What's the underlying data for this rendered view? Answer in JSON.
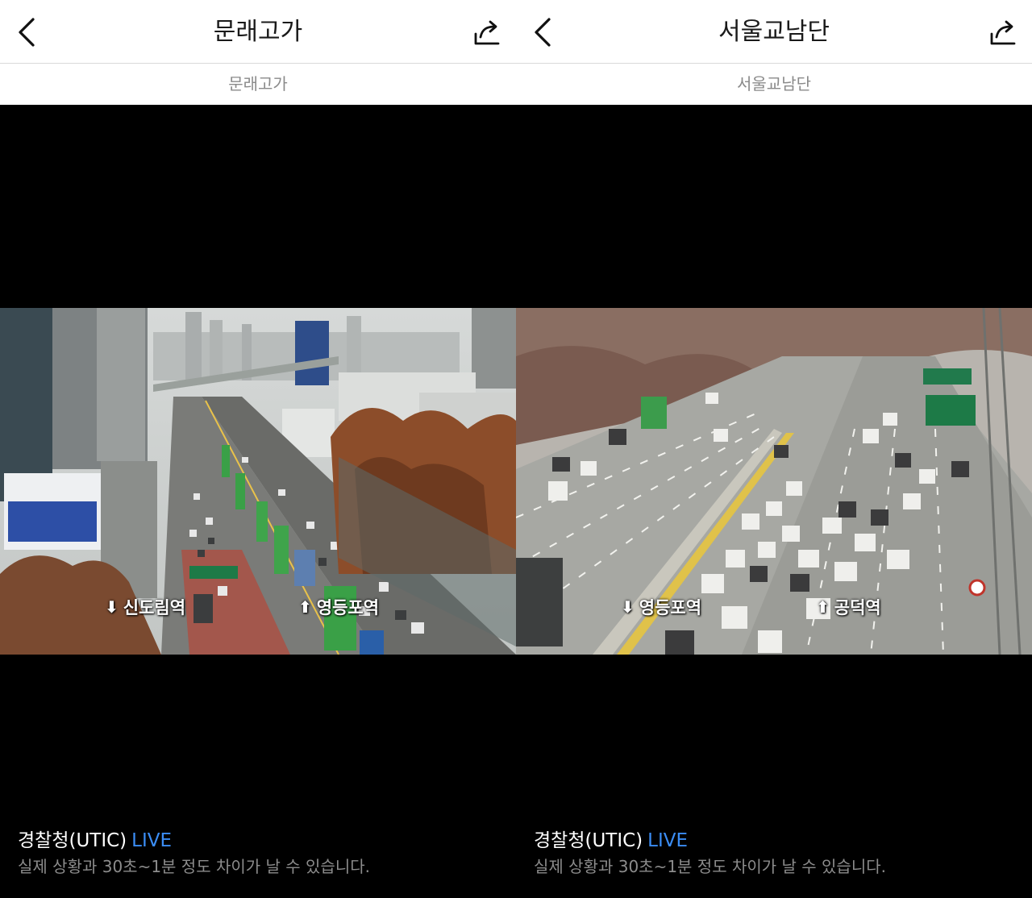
{
  "panels": [
    {
      "title": "문래고가",
      "subtitle": "문래고가",
      "labels": {
        "left": "신도림역",
        "right": "영등포역"
      },
      "source": "경찰청(UTIC)",
      "live": "LIVE",
      "notice": "실제 상황과 30초~1분 정도 차이가 날 수 있습니다."
    },
    {
      "title": "서울교남단",
      "subtitle": "서울교남단",
      "labels": {
        "left": "영등포역",
        "right": "공덕역"
      },
      "source": "경찰청(UTIC)",
      "live": "LIVE",
      "notice": "실제 상황과 30초~1분 정도 차이가 날 수 있습니다."
    }
  ],
  "colors": {
    "live": "#3b8df5",
    "background": "#000000",
    "header": "#ffffff"
  },
  "icons": {
    "back": "chevron-left-icon",
    "share": "share-arrow-icon"
  }
}
